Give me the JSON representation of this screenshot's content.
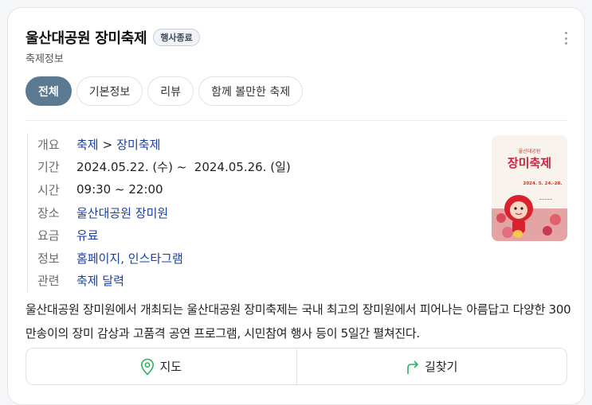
{
  "header": {
    "title": "울산대공원 장미축제",
    "badge": "행사종료",
    "subtitle": "축제정보"
  },
  "tabs": [
    {
      "label": "전체",
      "active": true
    },
    {
      "label": "기본정보",
      "active": false
    },
    {
      "label": "리뷰",
      "active": false
    },
    {
      "label": "함께 볼만한 축제",
      "active": false
    }
  ],
  "info": {
    "overview": {
      "label": "개요",
      "cat1": "축제",
      "sep": ">",
      "cat2": "장미축제"
    },
    "period": {
      "label": "기간",
      "value": "2024.05.22. (수) ~  2024.05.26. (일)"
    },
    "time": {
      "label": "시간",
      "value": "09:30 ~ 22:00"
    },
    "place": {
      "label": "장소",
      "value": "울산대공원 장미원"
    },
    "fee": {
      "label": "요금",
      "value": "유료"
    },
    "links": {
      "label": "정보",
      "homepage": "홈페이지",
      "comma": ",",
      "instagram": "인스타그램"
    },
    "related": {
      "label": "관련",
      "value": "축제 달력"
    }
  },
  "poster": {
    "title": "장미축제",
    "small_title": "울산대공원",
    "date": "2024. 5. 24.-28."
  },
  "description": "울산대공원 장미원에서 개최되는 울산대공원 장미축제는 국내 최고의 장미원에서 피어나는 아름답고 다양한 300만송이의 장미 감상과 고품격 공연 프로그램, 시민참여 행사 등이 5일간 펼쳐진다.",
  "actions": {
    "map": "지도",
    "directions": "길찾기"
  },
  "colors": {
    "active_tab": "#5b7a92",
    "link": "#1a3fa0",
    "map_icon": "#2bb35a"
  }
}
